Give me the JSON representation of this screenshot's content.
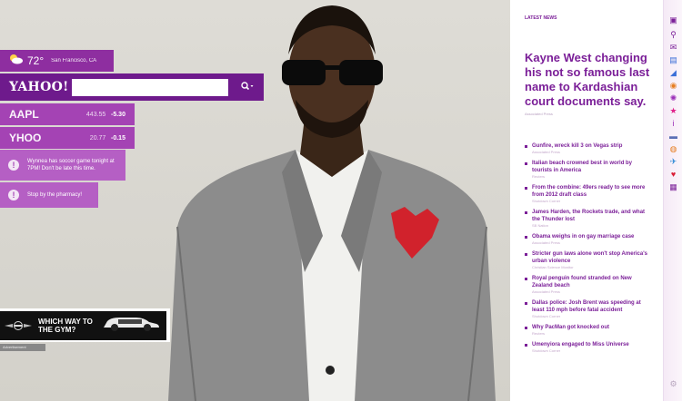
{
  "weather": {
    "temp": "72°",
    "location": "San Francisco, CA",
    "icon": "partly-cloudy-icon"
  },
  "search": {
    "logo": "YAHOO!",
    "placeholder": "",
    "value": ""
  },
  "stocks": [
    {
      "symbol": "AAPL",
      "price": "443.55",
      "change": "-5.30",
      "change_color": "#ffffff"
    },
    {
      "symbol": "YHOO",
      "price": "20.77",
      "change": "-0.15",
      "change_color": "#ffffff"
    }
  ],
  "reminders": [
    {
      "text": "Wynnea has soccer game tonight at 7PM! Don't be late this time."
    },
    {
      "text": "Stop by the pharmacy!"
    }
  ],
  "ad": {
    "headline": "WHICH WAY TO THE GYM?",
    "tag": "Advertisement"
  },
  "news": {
    "section_label": "LATEST NEWS",
    "headline": "Kayne West changing his not so famous last name to Kardashian court documents say.",
    "headline_source": "Associated Press",
    "items": [
      {
        "title": "Gunfire, wreck kill 3 on Vegas strip",
        "source": "Associated Press"
      },
      {
        "title": "Italian beach crowned best in world by tourists in America",
        "source": "Reuters"
      },
      {
        "title": "From the combine: 49ers ready to see more from 2012 draft class",
        "source": "Shutdown Corner"
      },
      {
        "title": "James Harden, the Rockets trade, and what the Thunder lost",
        "source": "SB Nation"
      },
      {
        "title": "Obama weighs in on gay marriage case",
        "source": "Associated Press"
      },
      {
        "title": "Stricter gun laws alone won't stop America's urban violence",
        "source": "Christian Science Monitor"
      },
      {
        "title": "Royal penguin found stranded on New Zealand beach",
        "source": "Associated Press"
      },
      {
        "title": "Dallas police: Josh Brent was speeding at least 110 mph before fatal accident",
        "source": "Shutdown Corner"
      },
      {
        "title": "Why PacMan got knocked out",
        "source": "Reuters"
      },
      {
        "title": "Umenyiora engaged to Miss Universe",
        "source": "Shutdown Corner"
      }
    ]
  },
  "rail_icons": [
    {
      "name": "avatar-icon",
      "glyph": "▣",
      "color": "#7b1f98"
    },
    {
      "name": "search-icon",
      "glyph": "⚲",
      "color": "#7b1f98"
    },
    {
      "name": "mail-icon",
      "glyph": "✉",
      "color": "#7b1f98"
    },
    {
      "name": "news-icon",
      "glyph": "▤",
      "color": "#3b6fd8"
    },
    {
      "name": "finance-icon",
      "glyph": "◢",
      "color": "#3b6fd8"
    },
    {
      "name": "sports-icon",
      "glyph": "◉",
      "color": "#e67e22"
    },
    {
      "name": "games-icon",
      "glyph": "✺",
      "color": "#9b30b8"
    },
    {
      "name": "flickr-icon",
      "glyph": "★",
      "color": "#e0218a"
    },
    {
      "name": "info-icon",
      "glyph": "i",
      "color": "#9b30b8"
    },
    {
      "name": "autos-icon",
      "glyph": "▬",
      "color": "#5a6fb5"
    },
    {
      "name": "shopping-icon",
      "glyph": "◍",
      "color": "#e67e22"
    },
    {
      "name": "travel-icon",
      "glyph": "✈",
      "color": "#2f8ad6"
    },
    {
      "name": "dating-icon",
      "glyph": "♥",
      "color": "#d91e36"
    },
    {
      "name": "jobs-icon",
      "glyph": "▦",
      "color": "#7b1f98"
    },
    {
      "name": "settings-icon",
      "glyph": "⚙",
      "color": "#b9a7bf"
    }
  ],
  "colors": {
    "brand_purple": "#7b1f98",
    "bar_dark": "#6e1a8c",
    "bar_mid": "#a443b4",
    "bar_light": "#b55fc4"
  }
}
